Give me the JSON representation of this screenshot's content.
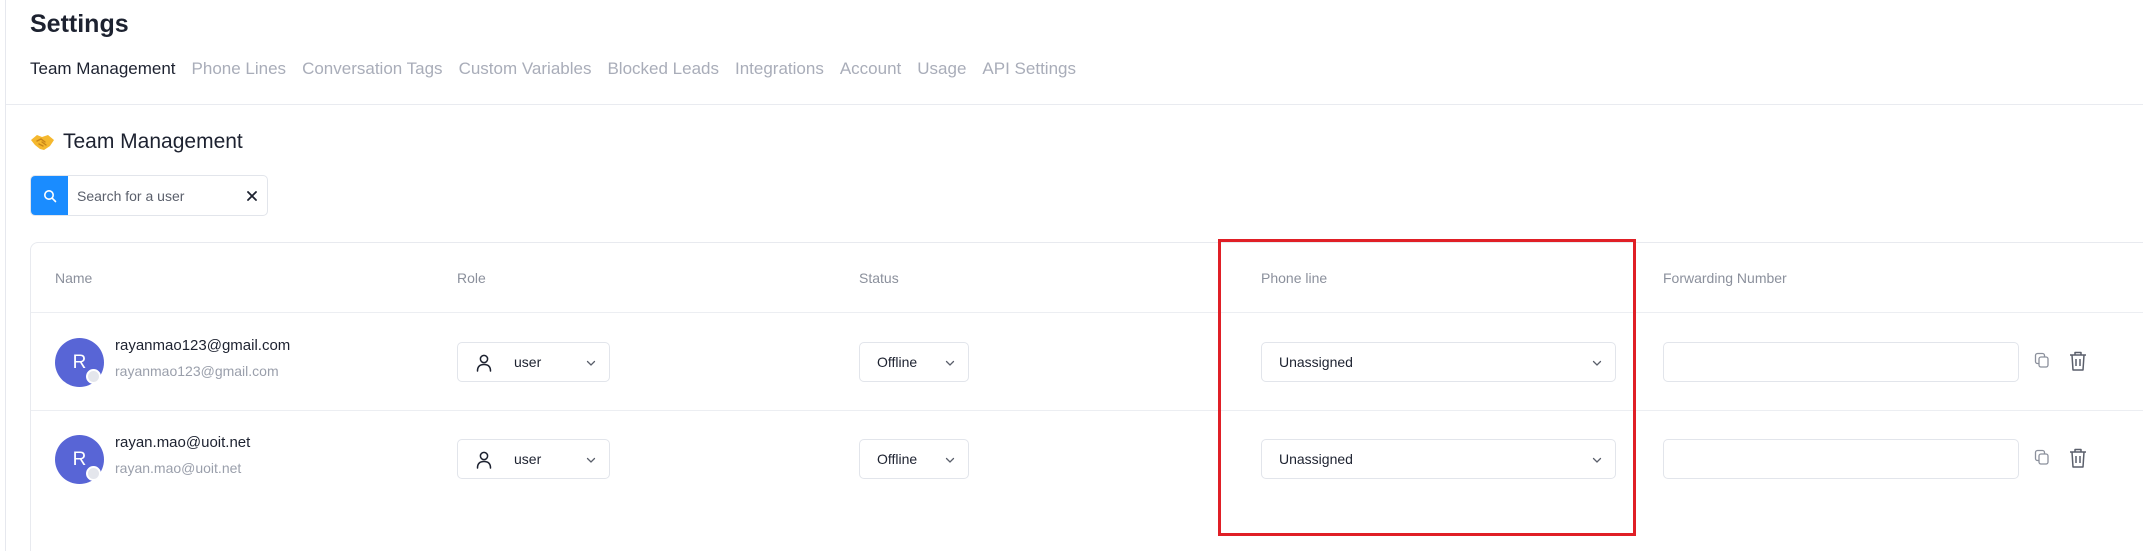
{
  "page": {
    "title": "Settings"
  },
  "tabs": [
    {
      "label": "Team Management",
      "active": true
    },
    {
      "label": "Phone Lines",
      "active": false
    },
    {
      "label": "Conversation Tags",
      "active": false
    },
    {
      "label": "Custom Variables",
      "active": false
    },
    {
      "label": "Blocked Leads",
      "active": false
    },
    {
      "label": "Integrations",
      "active": false
    },
    {
      "label": "Account",
      "active": false
    },
    {
      "label": "Usage",
      "active": false
    },
    {
      "label": "API Settings",
      "active": false
    }
  ],
  "section": {
    "title": "Team Management",
    "icon": "handshake-icon"
  },
  "search": {
    "placeholder": "Search for a user",
    "value": ""
  },
  "table": {
    "columns": {
      "name": "Name",
      "role": "Role",
      "status": "Status",
      "phone_line": "Phone line",
      "forwarding": "Forwarding Number"
    },
    "rows": [
      {
        "initial": "R",
        "email": "rayanmao123@gmail.com",
        "sub": "rayanmao123@gmail.com",
        "role": "user",
        "status": "Offline",
        "phone_line": "Unassigned",
        "forwarding_number": ""
      },
      {
        "initial": "R",
        "email": "rayan.mao@uoit.net",
        "sub": "rayan.mao@uoit.net",
        "role": "user",
        "status": "Offline",
        "phone_line": "Unassigned",
        "forwarding_number": ""
      }
    ]
  },
  "colors": {
    "accent": "#1a8cff",
    "avatar": "#5865d6",
    "highlight": "#e01f26",
    "muted_text": "#a9adb9"
  }
}
